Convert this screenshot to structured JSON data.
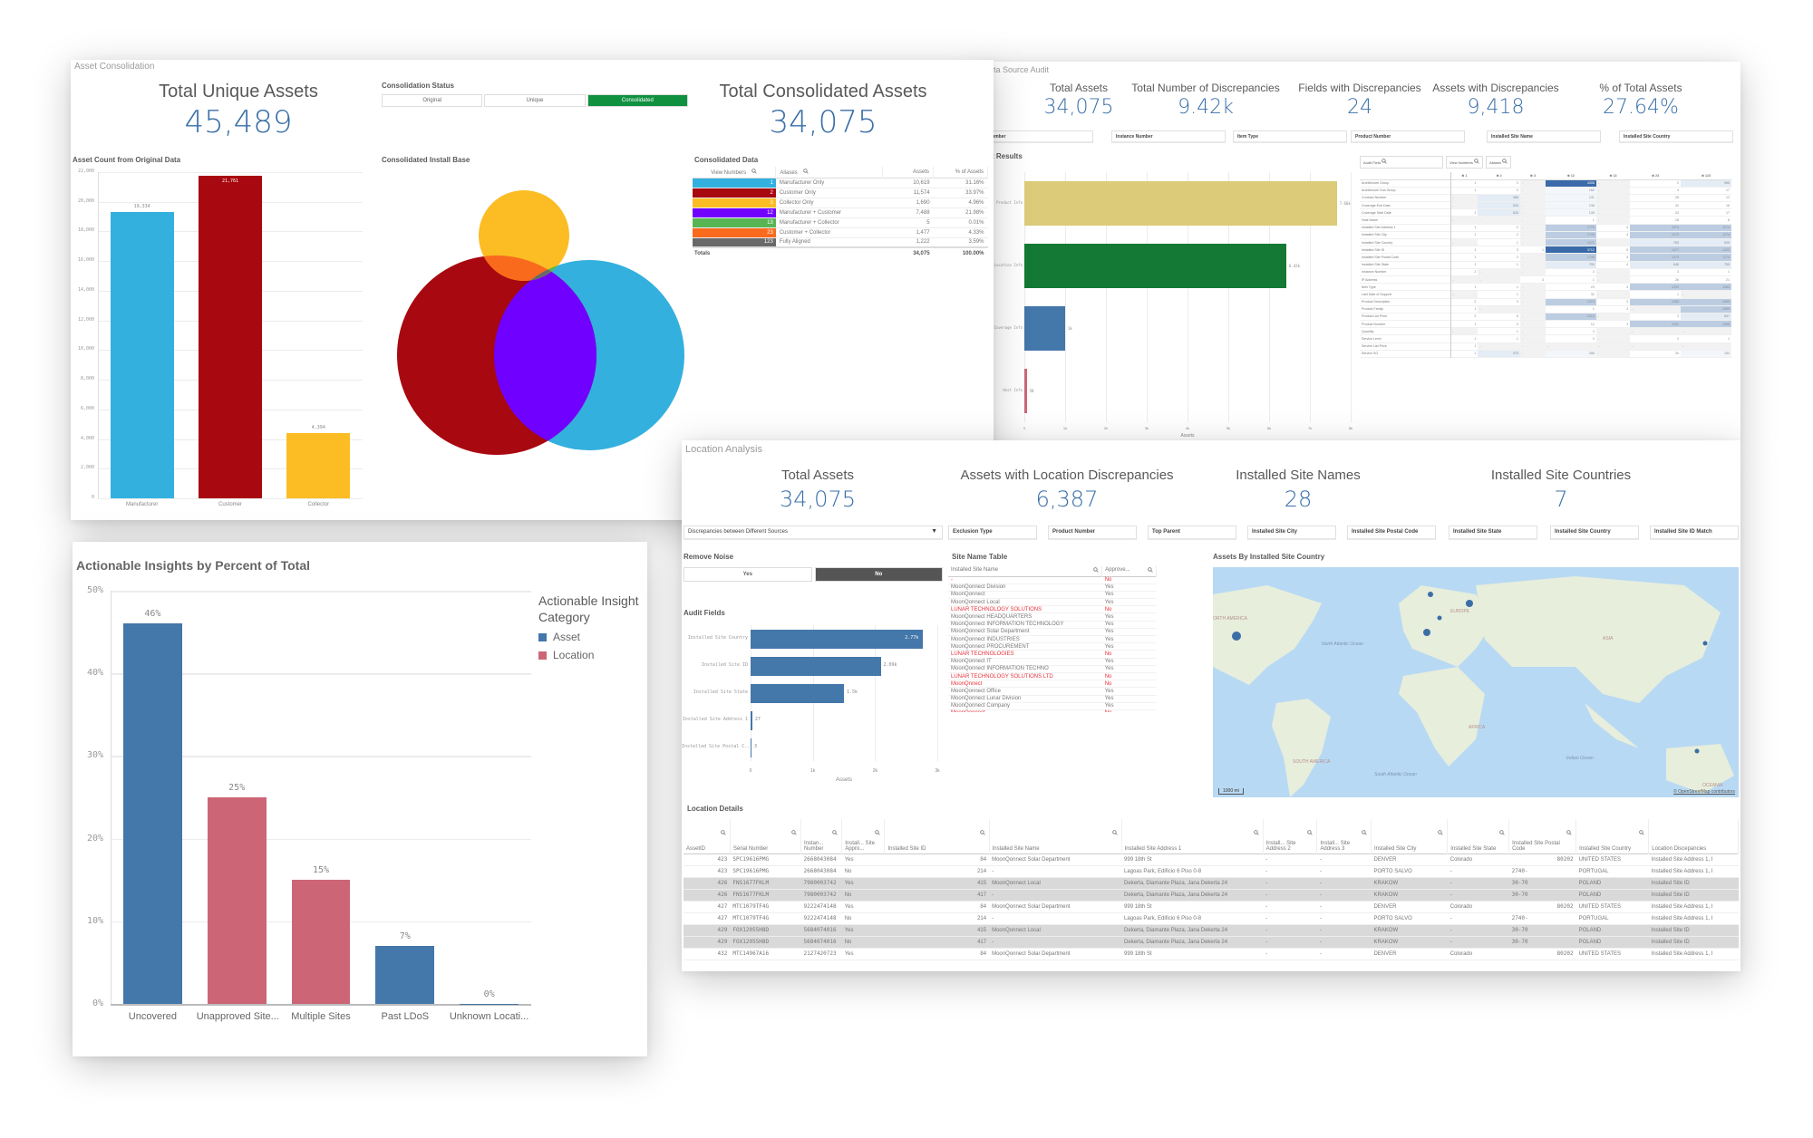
{
  "asset_consolidation": {
    "sheet_title": "Asset Consolidation",
    "kpi_unique": {
      "label": "Total Unique Assets",
      "value": "45,489"
    },
    "kpi_consolidated": {
      "label": "Total Consolidated Assets",
      "value": "34,075"
    },
    "status": {
      "title": "Consolidation Status",
      "options": [
        "Original",
        "Unique",
        "Consolidated"
      ],
      "selected": "Consolidated",
      "selected_color": "#0f9140"
    },
    "asset_count_chart": {
      "title": "Asset Count from Original Data",
      "type": "bar",
      "categories": [
        "Manufacturer",
        "Customer",
        "Collector"
      ],
      "values": [
        19334,
        21761,
        4394
      ],
      "value_labels": [
        "19,334",
        "21,761",
        "4,394"
      ],
      "colors": [
        "#33b0de",
        "#a8080f",
        "#fbbd23"
      ],
      "yticks": [
        "0",
        "2,000",
        "4,000",
        "6,000",
        "8,000",
        "10,000",
        "12,000",
        "14,000",
        "16,000",
        "18,000",
        "20,000",
        "22,000"
      ],
      "ylim": [
        0,
        22000
      ]
    },
    "venn": {
      "title": "Consolidated Install Base",
      "sets": [
        "Manufacturer",
        "Customer",
        "Collector"
      ],
      "colors": {
        "manufacturer": "#33b0de",
        "customer": "#a8080f",
        "collector": "#fbbd23",
        "mfr_cust": "#7000ff",
        "mfr_coll": "#58b553",
        "cust_coll": "#f96a1d",
        "all": "#696969"
      }
    },
    "consolidated_data": {
      "title": "Consolidated Data",
      "headers": [
        "View Numbers",
        "Aliases",
        "Assets",
        "% of Assets"
      ],
      "rows": [
        {
          "view": "1",
          "alias": "Manufacturer Only",
          "assets": "10,619",
          "pct": "31.16%",
          "color": "#33b0de"
        },
        {
          "view": "2",
          "alias": "Customer Only",
          "assets": "11,574",
          "pct": "33.97%",
          "color": "#a8080f"
        },
        {
          "view": "3",
          "alias": "Collector Only",
          "assets": "1,690",
          "pct": "4.96%",
          "color": "#fbbd23"
        },
        {
          "view": "12",
          "alias": "Manufacturer + Customer",
          "assets": "7,488",
          "pct": "21.98%",
          "color": "#7000ff"
        },
        {
          "view": "13",
          "alias": "Manufacturer + Collector",
          "assets": "5",
          "pct": "0.01%",
          "color": "#58b553"
        },
        {
          "view": "23",
          "alias": "Customer + Collector",
          "assets": "1,477",
          "pct": "4.33%",
          "color": "#f96a1d"
        },
        {
          "view": "123",
          "alias": "Fully Aligned",
          "assets": "1,222",
          "pct": "3.59%",
          "color": "#696969"
        }
      ],
      "totals": {
        "label": "Totals",
        "assets": "34,075",
        "pct": "100.00%"
      }
    }
  },
  "data_source_audit": {
    "sheet_title": "ta Source Audit",
    "kpis": [
      {
        "label": "Total Assets",
        "value": "34,075"
      },
      {
        "label": "Total Number of Discrepancies",
        "value": "9.42k"
      },
      {
        "label": "Fields with Discrepancies",
        "value": "24"
      },
      {
        "label": "Assets with Discrepancies",
        "value": "9,418"
      },
      {
        "label": "% of Total Assets",
        "value": "27.64%"
      }
    ],
    "filters": [
      "al Number",
      "Instance Number",
      "Item Type",
      "Product Number",
      "Installed Site Name",
      "Installed Site Country"
    ],
    "results_chart": {
      "title": "t Results",
      "type": "bar",
      "orientation": "horizontal",
      "categories": [
        "Product Info",
        "Location Info",
        "Coverage Info",
        "Host Info"
      ],
      "values": [
        7660,
        6420,
        1000,
        58
      ],
      "value_labels": [
        "7.66k",
        "6.42k",
        "1k",
        "58"
      ],
      "colors": [
        "#dccb78",
        "#137934",
        "#4477aa",
        "#cc6677"
      ],
      "xticks": [
        "0",
        "1k",
        "2k",
        "3k",
        "4k",
        "5k",
        "6k",
        "7k",
        "8k"
      ],
      "xlim": [
        0,
        8000
      ],
      "xlabel": "Assets"
    },
    "pivot": {
      "row_header": "Audit Field",
      "col_filters": [
        "View Numbers",
        "Aliases"
      ],
      "columns": [
        "1",
        "2",
        "3",
        "12",
        "13",
        "23",
        "123"
      ],
      "rows": [
        {
          "field": "Architecture Group",
          "cells": [
            "1",
            "3",
            "-",
            "4308",
            "-",
            "2",
            "956"
          ]
        },
        {
          "field": "Architecture Sub Group",
          "cells": [
            "1",
            "3",
            "-",
            "162",
            "-",
            "4",
            "17"
          ]
        },
        {
          "field": "Contract Number",
          "cells": [
            "-",
            "468",
            "-",
            "131",
            "-",
            "28",
            "12"
          ]
        },
        {
          "field": "Coverage End Date",
          "cells": [
            "-",
            "526",
            "-",
            "138",
            "-",
            "32",
            "16"
          ]
        },
        {
          "field": "Coverage Start Date",
          "cells": [
            "1",
            "526",
            "-",
            "135",
            "-",
            "33",
            "17"
          ]
        },
        {
          "field": "Host Name",
          "cells": [
            "-",
            "-",
            "-",
            "1",
            "-",
            "28",
            "8"
          ]
        },
        {
          "field": "Installed Site Address 1",
          "cells": [
            "1",
            "2",
            "-",
            "1775",
            "4",
            "1374",
            "1174"
          ]
        },
        {
          "field": "Installed Site City",
          "cells": [
            "1",
            "2",
            "-",
            "1749",
            "4",
            "1373",
            "1174"
          ]
        },
        {
          "field": "Installed Site Country",
          "cells": [
            "-",
            "1",
            "-",
            "1071",
            "-",
            "783",
            "929"
          ]
        },
        {
          "field": "Installed Site ID",
          "cells": [
            "1",
            "3",
            "1",
            "3712",
            "5",
            "1477",
            "1222"
          ]
        },
        {
          "field": "Installed Site Postal Code",
          "cells": [
            "1",
            "2",
            "-",
            "1749",
            "4",
            "1373",
            "1174"
          ]
        },
        {
          "field": "Installed Site State",
          "cells": [
            "1",
            "1",
            "-",
            "750",
            "4",
            "646",
            "755"
          ]
        },
        {
          "field": "Instance Number",
          "cells": [
            "2",
            "-",
            "-",
            "3",
            "-",
            "3",
            "1"
          ]
        },
        {
          "field": "IP Address",
          "cells": [
            "-",
            "-",
            "3",
            "1",
            "-",
            "26",
            "21"
          ]
        },
        {
          "field": "Item Type",
          "cells": [
            "1",
            "1",
            "-",
            "23",
            "3",
            "1292",
            "1063"
          ]
        },
        {
          "field": "Last Date of Support",
          "cells": [
            "-",
            "1",
            "-",
            "32",
            "-",
            "1",
            "-"
          ]
        },
        {
          "field": "Product Description",
          "cells": [
            "2",
            "3",
            "-",
            "1473",
            "3",
            "1283",
            "1065"
          ]
        },
        {
          "field": "Product Family",
          "cells": [
            "1",
            "-",
            "-",
            "1",
            "3",
            "-",
            "1059"
          ]
        },
        {
          "field": "Product List Price",
          "cells": [
            "2",
            "6",
            "-",
            "1213",
            "-",
            "2",
            "837"
          ]
        },
        {
          "field": "Product Number",
          "cells": [
            "1",
            "3",
            "-",
            "12",
            "3",
            "1302",
            "1065"
          ]
        },
        {
          "field": "Quantity",
          "cells": [
            "-",
            "1",
            "-",
            "3",
            "-",
            "-",
            "-"
          ]
        },
        {
          "field": "Service Level",
          "cells": [
            "1",
            "1",
            "-",
            "3",
            "-",
            "2",
            "1"
          ]
        },
        {
          "field": "Service List Price",
          "cells": [
            "1",
            "-",
            "-",
            "-",
            "-",
            "-",
            "-"
          ]
        },
        {
          "field": "Service SO",
          "cells": [
            "1",
            "475",
            "-",
            "286",
            "-",
            "30",
            "153"
          ]
        }
      ]
    }
  },
  "actionable_insights": {
    "chart_data": {
      "type": "bar",
      "title": "Actionable Insights by Percent of Total",
      "categories": [
        "Uncovered",
        "Unapproved Site...",
        "Multiple Sites",
        "Past LDoS",
        "Unknown Locati..."
      ],
      "values": [
        46,
        25,
        15,
        7,
        0
      ],
      "value_labels": [
        "46%",
        "25%",
        "15%",
        "7%",
        "0%"
      ],
      "series_of_category": [
        "Asset",
        "Location",
        "Location",
        "Asset",
        "Asset"
      ],
      "yticks": [
        "0%",
        "10%",
        "20%",
        "30%",
        "40%",
        "50%"
      ],
      "ylim": [
        0,
        50
      ],
      "ylabel": "",
      "xlabel": "",
      "grid": true,
      "legend": {
        "title": "Actionable Insight Category",
        "position": "right",
        "items": [
          {
            "name": "Asset",
            "color": "#4477aa"
          },
          {
            "name": "Location",
            "color": "#cc6677"
          }
        ]
      }
    }
  },
  "location_analysis": {
    "sheet_title": "Location Analysis",
    "kpis": [
      {
        "label": "Total Assets",
        "value": "34,075"
      },
      {
        "label": "Assets with Location Discrepancies",
        "value": "6,387"
      },
      {
        "label": "Installed Site Names",
        "value": "28"
      },
      {
        "label": "Installed Site Countries",
        "value": "7"
      }
    ],
    "dropdown": {
      "value": "Discrepancies between Different Sources",
      "icon": "caret-down-icon"
    },
    "filters": [
      "Exclusion Type",
      "Product Number",
      "Top Parent",
      "Installed Site City",
      "Installed Site Postal Code",
      "Installed Site State",
      "Installed Site Country",
      "Installed Site ID Match"
    ],
    "remove_noise": {
      "title": "Remove Noise",
      "options": [
        "Yes",
        "No"
      ],
      "selected": "No"
    },
    "audit_fields": {
      "title": "Audit Fields",
      "type": "bar",
      "orientation": "horizontal",
      "categories": [
        "Installed Site Country",
        "Installed Site ID",
        "Installed Site State",
        "Installed Site Address 1",
        "Installed Site Postal C..."
      ],
      "values": [
        2770,
        2090,
        1500,
        27,
        3
      ],
      "value_labels": [
        "2.77k",
        "2.09k",
        "1.5k",
        "27",
        "3"
      ],
      "xticks": [
        "0",
        "1k",
        "2k",
        "3k"
      ],
      "xlim": [
        0,
        3000
      ],
      "xlabel": "Assets",
      "color": "#4477aa"
    },
    "site_name_table": {
      "title": "Site Name Table",
      "headers": [
        "Installed Site Name",
        "Approve..."
      ],
      "rows": [
        {
          "name": "-",
          "approved": "No"
        },
        {
          "name": "MoonQonnect Division",
          "approved": "Yes"
        },
        {
          "name": "MoonQonnect",
          "approved": "Yes"
        },
        {
          "name": "MoonQonnect Local",
          "approved": "Yes"
        },
        {
          "name": "LUNAR TECHNOLOGY SOLUTIONS",
          "approved": "No"
        },
        {
          "name": "MoonQonnect HEADQUARTERS",
          "approved": "Yes"
        },
        {
          "name": "MoonQonnect INFORMATION TECHNOLOGY",
          "approved": "Yes"
        },
        {
          "name": "MoonQonnect Solar Department",
          "approved": "Yes"
        },
        {
          "name": "MoonQonnect INDUSTRIES",
          "approved": "Yes"
        },
        {
          "name": "MoonQonnect PROCUREMENT",
          "approved": "Yes"
        },
        {
          "name": "LUNAR TECHNOLOGIES",
          "approved": "No"
        },
        {
          "name": "MoonQonnect IT",
          "approved": "Yes"
        },
        {
          "name": "MoonQonnect INFORMATION TECHNO",
          "approved": "Yes"
        },
        {
          "name": "LUNAR TECHNOLOGY SOLUTIONS LTD",
          "approved": "No"
        },
        {
          "name": "MoonQnnect",
          "approved": "No"
        },
        {
          "name": "MoonQonnect Office",
          "approved": "Yes"
        },
        {
          "name": "MoonQonnect Lunar Division",
          "approved": "Yes"
        },
        {
          "name": "MoonQonnect Company",
          "approved": "Yes"
        },
        {
          "name": "MoonQonnect",
          "approved": "No"
        }
      ]
    },
    "map": {
      "title": "Assets By Installed Site Country",
      "labels": [
        "ORTH AMERICA",
        "North Atlantic Ocean",
        "EUROPE",
        "ASIA",
        "AFRICA",
        "SOUTH AMERICA",
        "South Atlantic Ocean",
        "Indian Ocean",
        "OCEANIA"
      ],
      "scale": "1000 mi",
      "attribution": "© OpenStreetMap contributors"
    },
    "location_details": {
      "title": "Location Details",
      "headers": [
        "AssetID",
        "Serial Number",
        "Instan... Number",
        "Install... Site Appro...",
        "Installed Site ID",
        "Installed Site Name",
        "Installed Site Address 1",
        "Install... Site Address 2",
        "Install... Site Address 3",
        "Installed Site City",
        "Installed Site State",
        "Installed Site Postal Code",
        "Installed Site Country",
        "Location Discepancies"
      ],
      "rows": [
        [
          "423",
          "SPC19616PMG",
          "2668043084",
          "Yes",
          "84",
          "MoonQonnect Solar Department",
          "999 18th St",
          "-",
          "-",
          "DENVER",
          "Colorado",
          "80202",
          "UNITED STATES",
          "Installed Site Address 1, I"
        ],
        [
          "423",
          "SPC19616PMG",
          "2668043084",
          "No",
          "214",
          "-",
          "Lagoas Park, Edificio 6 Piso 0-8",
          "-",
          "-",
          "PORTO SALVO",
          "-",
          "2740-",
          "PORTUGAL",
          "Installed Site Address 1, I"
        ],
        [
          "426",
          "FNS1677FKLM",
          "7980003742",
          "Yes",
          "415",
          "MoonQonnect Local",
          "Dekerta, Diamante Plaza, Jana Dekerta 24",
          "-",
          "-",
          "KRAKOW",
          "-",
          "30-70",
          "POLAND",
          "Installed Site ID"
        ],
        [
          "426",
          "FNS1677FKLM",
          "7980003742",
          "No",
          "417",
          "-",
          "Dekerta, Diamante Plaza, Jana Dekerta 24",
          "-",
          "-",
          "KRAKOW",
          "-",
          "30-70",
          "POLAND",
          "Installed Site ID"
        ],
        [
          "427",
          "MTC1079TF4G",
          "9222474148",
          "Yes",
          "84",
          "MoonQonnect Solar Department",
          "999 18th St",
          "-",
          "-",
          "DENVER",
          "Colorado",
          "80202",
          "UNITED STATES",
          "Installed Site Address 1, I"
        ],
        [
          "427",
          "MTC1079TF4G",
          "9222474148",
          "No",
          "214",
          "-",
          "Lagoas Park, Edificio 6 Piso 0-8",
          "-",
          "-",
          "PORTO SALVO",
          "-",
          "2740-",
          "PORTUGAL",
          "Installed Site Address 1, I"
        ],
        [
          "429",
          "FOX12055H8D",
          "5684074016",
          "Yes",
          "415",
          "MoonQonnect Local",
          "Dekerta, Diamante Plaza, Jana Dekerta 24",
          "-",
          "-",
          "KRAKOW",
          "-",
          "30-70",
          "POLAND",
          "Installed Site ID"
        ],
        [
          "429",
          "FOX12055H8D",
          "5684074016",
          "No",
          "417",
          "-",
          "Dekerta, Diamante Plaza, Jana Dekerta 24",
          "-",
          "-",
          "KRAKOW",
          "-",
          "30-70",
          "POLAND",
          "Installed Site ID"
        ],
        [
          "432",
          "MTC14967A16",
          "2127420723",
          "Yes",
          "84",
          "MoonQonnect Solar Department",
          "999 18th St",
          "-",
          "-",
          "DENVER",
          "Colorado",
          "80202",
          "UNITED STATES",
          "Installed Site Address 1, I"
        ]
      ],
      "shaded_rows": [
        2,
        3,
        6,
        7
      ]
    }
  }
}
